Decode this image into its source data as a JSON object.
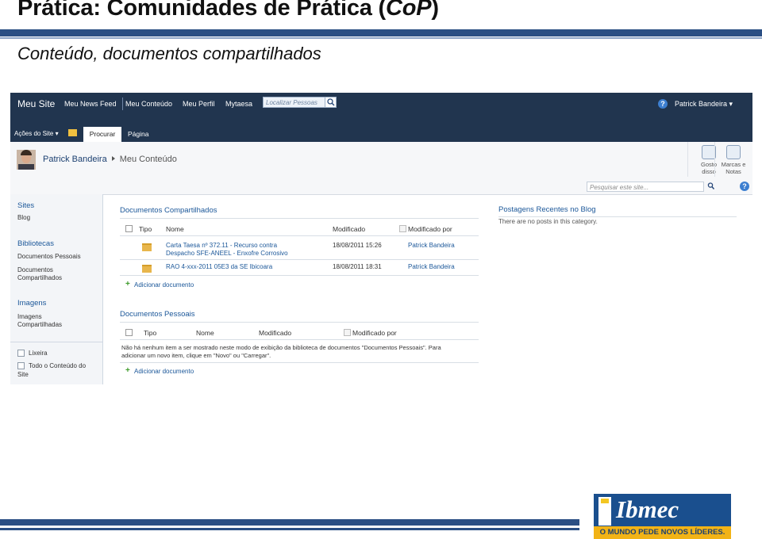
{
  "slide": {
    "title_plain": "Prática: Comunidades de Prática (",
    "title_italic": "CoP",
    "title_close": ")",
    "subtitle": "Conteúdo, documentos compartilhados"
  },
  "topnav": {
    "site": "Meu Site",
    "links": [
      "Meu News Feed",
      "Meu Conteúdo",
      "Meu Perfil",
      "Mytaesa"
    ],
    "search_placeholder": "Localizar Pessoas",
    "user": "Patrick Bandeira ▾"
  },
  "ribbon": {
    "acoes": "Ações do Site ▾",
    "tabs": [
      "Procurar",
      "Página"
    ]
  },
  "header": {
    "breadcrumb_user": "Patrick Bandeira",
    "breadcrumb_current": "Meu Conteúdo",
    "actions": [
      {
        "line1": "Gosto",
        "line2": "disso"
      },
      {
        "line1": "Marcas e",
        "line2": "Notas"
      }
    ],
    "site_search_placeholder": "Pesquisar este site..."
  },
  "left_nav": {
    "sites_header": "Sites",
    "sites_items": [
      "Blog"
    ],
    "bibliotecas_header": "Bibliotecas",
    "bibliotecas_items": [
      "Documentos Pessoais",
      "Documentos",
      "Compartilhados"
    ],
    "imagens_header": "Imagens",
    "imagens_items": [
      "Imagens",
      "Compartilhadas"
    ],
    "lixeira": "Lixeira",
    "todo_line1": "Todo o Conteúdo do",
    "todo_line2": "Site"
  },
  "shared_docs": {
    "title": "Documentos Compartilhados",
    "columns": [
      "Tipo",
      "Nome",
      "Modificado",
      "Modificado por"
    ],
    "rows": [
      {
        "name_line1": "Carta Taesa nº 372.11 - Recurso contra",
        "name_line2": "Despacho SFE-ANEEL - Enxofre Corrosivo",
        "modified": "18/08/2011 15:26",
        "by": "Patrick Bandeira"
      },
      {
        "name_line1": "RAO 4-xxx-2011 05E3 da SE Ibicoara",
        "name_line2": "",
        "modified": "18/08/2011 18:31",
        "by": "Patrick Bandeira"
      }
    ],
    "add": "Adicionar documento"
  },
  "personal_docs": {
    "title": "Documentos Pessoais",
    "columns": [
      "Tipo",
      "Nome",
      "Modificado",
      "Modificado por"
    ],
    "empty_line1": "Não há nenhum item a ser mostrado neste modo de exibição da biblioteca de documentos \"Documentos Pessoais\". Para",
    "empty_line2": "adicionar um novo item, clique em \"Novo\" ou \"Carregar\".",
    "add": "Adicionar documento"
  },
  "blog": {
    "title": "Postagens Recentes no Blog",
    "empty": "There are no posts in this category."
  },
  "logo": {
    "word": "Ibmec",
    "tagline": "O MUNDO PEDE NOVOS LÍDERES."
  },
  "colors": {
    "nav_dark": "#21354f",
    "link_blue": "#1b5799",
    "bar_blue": "#2b4f84",
    "logo_yellow": "#f2b316"
  }
}
